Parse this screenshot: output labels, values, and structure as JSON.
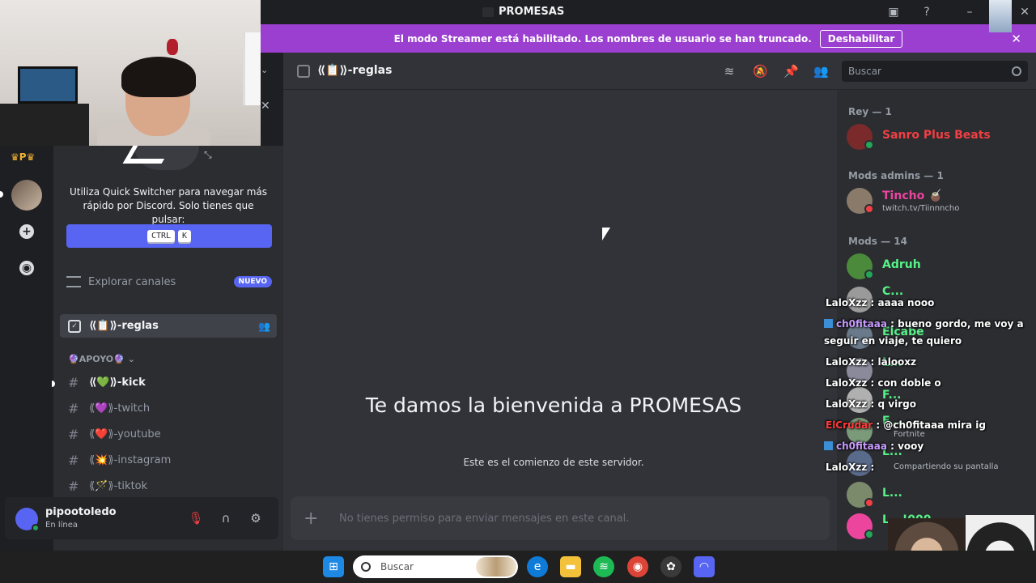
{
  "window": {
    "title": "PROMESAS"
  },
  "banner": {
    "text": "El modo Streamer está habilitado. Los nombres de usuario se han truncado.",
    "button": "Deshabilitar"
  },
  "rail": {
    "top_label": "♛P♛"
  },
  "sidebar": {
    "quick_switcher_text": "Utiliza Quick Switcher para navegar más rápido por Discord. Solo tienes que pulsar:",
    "keys": [
      "CTRL",
      "K"
    ],
    "explore_label": "Explorar canales",
    "explore_badge": "NUEVO",
    "active_channel": "⟪📋⟫-reglas",
    "category": "🔮APOYO🔮",
    "channels": [
      {
        "name": "⟪💚⟫-kick",
        "unread": true
      },
      {
        "name": "⟪💜⟫-twitch",
        "unread": false
      },
      {
        "name": "⟪❤️⟫-youtube",
        "unread": false
      },
      {
        "name": "⟪💥⟫-instagram",
        "unread": false
      },
      {
        "name": "⟪🪄⟫-tiktok",
        "unread": false
      }
    ]
  },
  "user_panel": {
    "name": "pipootoledo",
    "status": "En línea"
  },
  "header": {
    "channel": "⟪📋⟫-reglas",
    "search_placeholder": "Buscar"
  },
  "main": {
    "welcome_title": "Te damos la bienvenida a PROMESAS",
    "welcome_sub": "Este es el comienzo de este servidor.",
    "composer_placeholder": "No tienes permiso para enviar mensajes en este canal."
  },
  "members": {
    "groups": [
      {
        "label": "Rey — 1"
      },
      {
        "label": "Mods admins — 1"
      },
      {
        "label": "Mods — 14"
      }
    ],
    "items": [
      {
        "name": "Sanro Plus Beats",
        "color": "#f23f43",
        "sub": ""
      },
      {
        "name": "Tincho 🧉",
        "color": "#eb459e",
        "sub": "twitch.tv/Tiinnncho"
      },
      {
        "name": "Adruh",
        "color": "#57f287",
        "sub": ""
      }
    ],
    "partial": [
      {
        "name": "C...",
        "sub": ""
      },
      {
        "name": "Elcabe",
        "sub": ""
      },
      {
        "name": "L...",
        "sub": ""
      },
      {
        "name": "F...",
        "sub": ""
      },
      {
        "name": "F...",
        "sub": "Fortnite"
      },
      {
        "name": "L...",
        "sub": "Compartiendo su pantalla"
      },
      {
        "name": "L...",
        "sub": ""
      },
      {
        "name": "L...!000",
        "sub": ""
      }
    ]
  },
  "chat": [
    {
      "user": "LaloXzz",
      "color": "#ffffff",
      "badge": false,
      "text": ": aaaa nooo"
    },
    {
      "user": "ch0fitaaa",
      "color": "#c89cff",
      "badge": true,
      "text": ": bueno gordo, me voy a seguir en viaje, te quiero"
    },
    {
      "user": "LaloXzz",
      "color": "#ffffff",
      "badge": false,
      "text": ": lalooxz"
    },
    {
      "user": "LaloXzz",
      "color": "#ffffff",
      "badge": false,
      "text": ": con doble o"
    },
    {
      "user": "LaloXzz",
      "color": "#ffffff",
      "badge": false,
      "text": ": q virgo"
    },
    {
      "user": "ElCrudar",
      "color": "#ff3b3b",
      "badge": false,
      "text": ": @ch0fitaaa mira ig"
    },
    {
      "user": "ch0fitaaa",
      "color": "#c89cff",
      "badge": true,
      "text": ": vooy"
    },
    {
      "user": "LaloXzz",
      "color": "#ffffff",
      "badge": false,
      "text": ":"
    }
  ],
  "taskbar": {
    "search_placeholder": "Buscar"
  }
}
